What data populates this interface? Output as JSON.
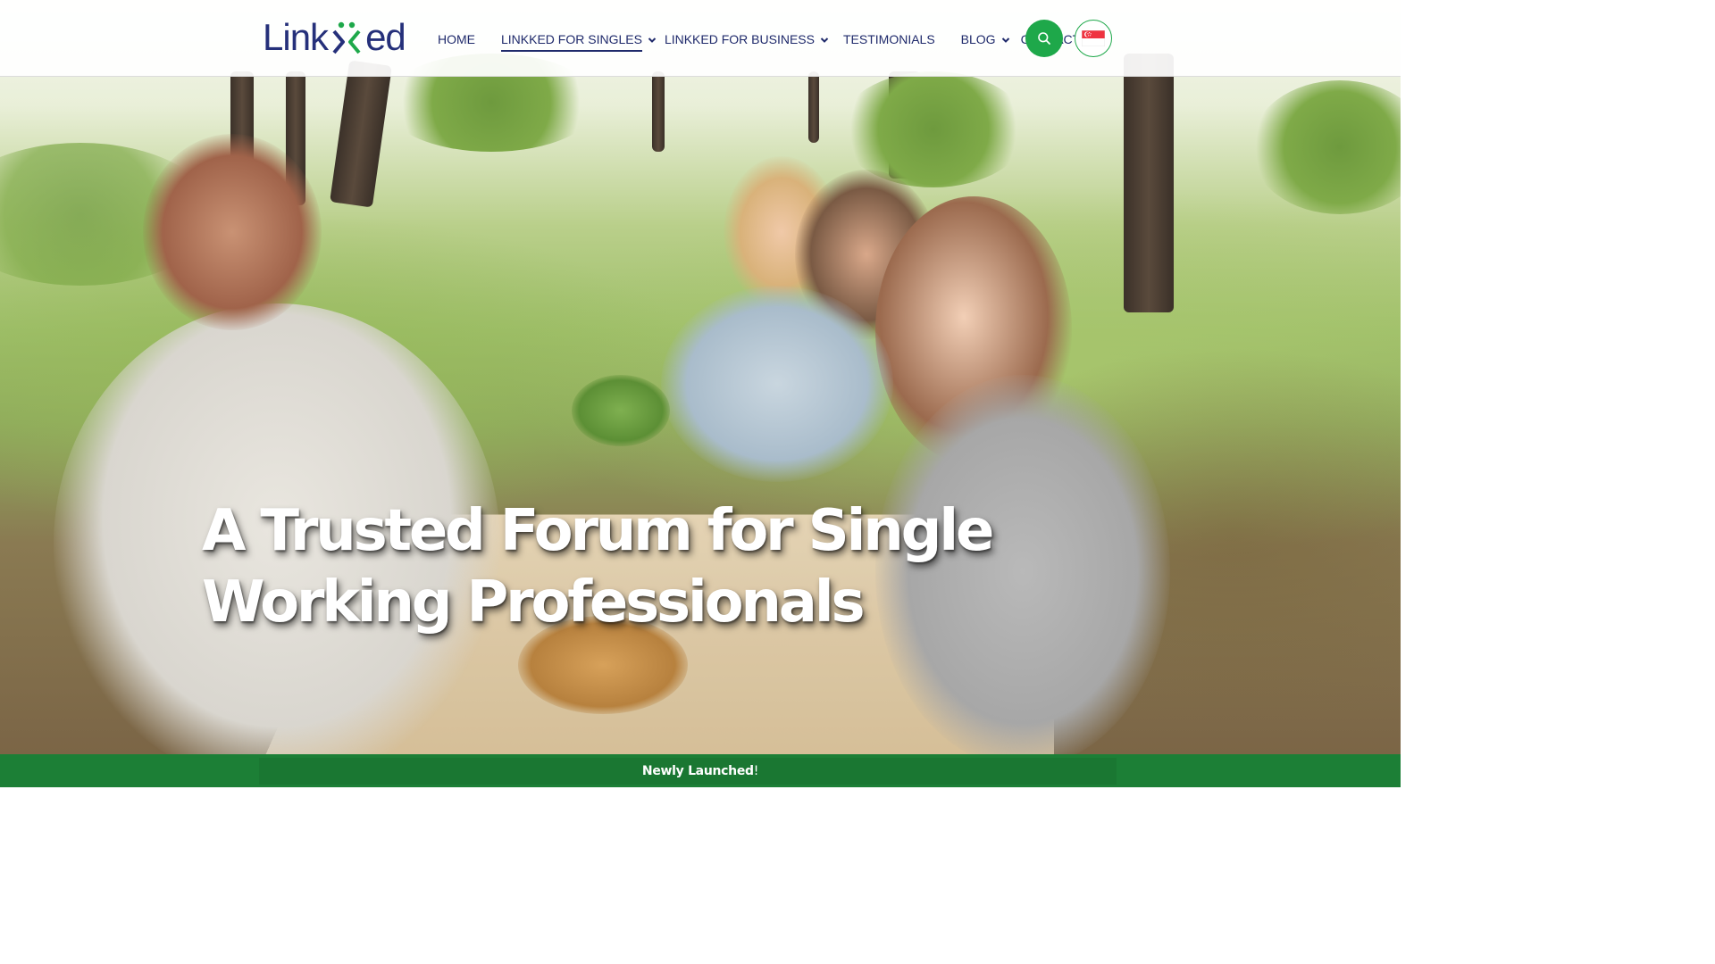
{
  "header": {
    "logo_text_left": "Link",
    "logo_text_right": "ed",
    "logo_alt": "Linkked",
    "nav": [
      {
        "label": "HOME",
        "has_dropdown": false,
        "active": false
      },
      {
        "label": "LINKKED FOR SINGLES",
        "has_dropdown": true,
        "active": true
      },
      {
        "label": "LINKKED FOR BUSINESS",
        "has_dropdown": true,
        "active": false
      },
      {
        "label": "TESTIMONIALS",
        "has_dropdown": false,
        "active": false
      },
      {
        "label": "BLOG",
        "has_dropdown": true,
        "active": false
      },
      {
        "label": "CONTACT",
        "has_dropdown": false,
        "active": false
      }
    ],
    "search_icon": "search-icon",
    "flag_icon": "singapore-flag-icon"
  },
  "hero": {
    "title_line1": "A Trusted Forum for Single",
    "title_line2": "Working Professionals"
  },
  "banner": {
    "text_bold": "Newly Launched",
    "text_tail": "!"
  },
  "colors": {
    "brand_navy": "#25307a",
    "brand_green": "#1ea84a",
    "banner_green": "#1c7f36"
  }
}
